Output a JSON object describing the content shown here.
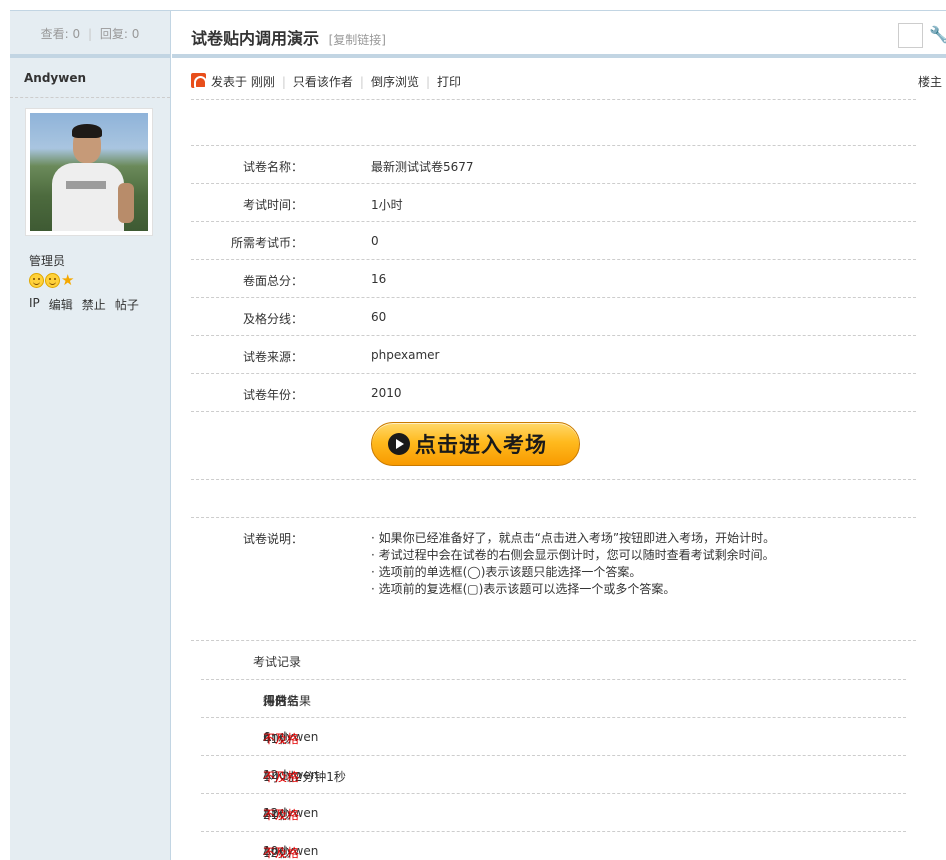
{
  "sidebar": {
    "views_label": "查看:",
    "views": "0",
    "replies_label": "回复:",
    "replies": "0",
    "author": "Andywen",
    "role": "管理员",
    "admin_links": [
      "IP",
      "编辑",
      "禁止",
      "帖子"
    ]
  },
  "thread": {
    "title": "试卷贴内调用演示",
    "copy_link": "[复制链接]"
  },
  "post": {
    "posted_at": "发表于 刚刚",
    "links": [
      "只看该作者",
      "倒序浏览",
      "打印"
    ],
    "floor": "楼主"
  },
  "exam": {
    "fields": [
      {
        "label": "试卷名称：",
        "value": "最新测试试卷5677"
      },
      {
        "label": "考试时间：",
        "value": "1小时"
      },
      {
        "label": "所需考试币：",
        "value": "0"
      },
      {
        "label": "卷面总分：",
        "value": "16"
      },
      {
        "label": "及格分线：",
        "value": "60"
      },
      {
        "label": "试卷来源：",
        "value": "phpexamer"
      },
      {
        "label": "试卷年份：",
        "value": "2010"
      }
    ],
    "enter_button": "点击进入考场",
    "desc_label": "试卷说明：",
    "desc_lines": [
      "· 如果你已经准备好了，就点击“点击进入考场”按钮即进入考场，开始计时。",
      "· 考试过程中会在试卷的右侧会显示倒计时，您可以随时查看考试剩余时间。",
      "· 选项前的单选框(◯)表示该题只能选择一个答案。",
      "· 选项前的复选框(▢)表示该题可以选择一个或多个答案。"
    ],
    "records_label": "考试记录",
    "records_headers": [
      "用户名",
      "用时",
      "得分",
      "评估结果"
    ],
    "records": [
      {
        "user": "Andywen",
        "time": "41秒",
        "score": "6",
        "result": "不及格"
      },
      {
        "user": "Andywen",
        "time": "1小时2分钟1秒",
        "score": "12",
        "result": "不及格"
      },
      {
        "user": "Andywen",
        "time": "21秒",
        "score": "12",
        "result": "不及格"
      },
      {
        "user": "Andywen",
        "time": "12秒",
        "score": "10",
        "result": "不及格"
      }
    ]
  },
  "colors": {
    "sidebar_bg": "#e5edf2",
    "border": "#c2d5e3",
    "fail": "#e60000",
    "button": "#ffba1e"
  }
}
